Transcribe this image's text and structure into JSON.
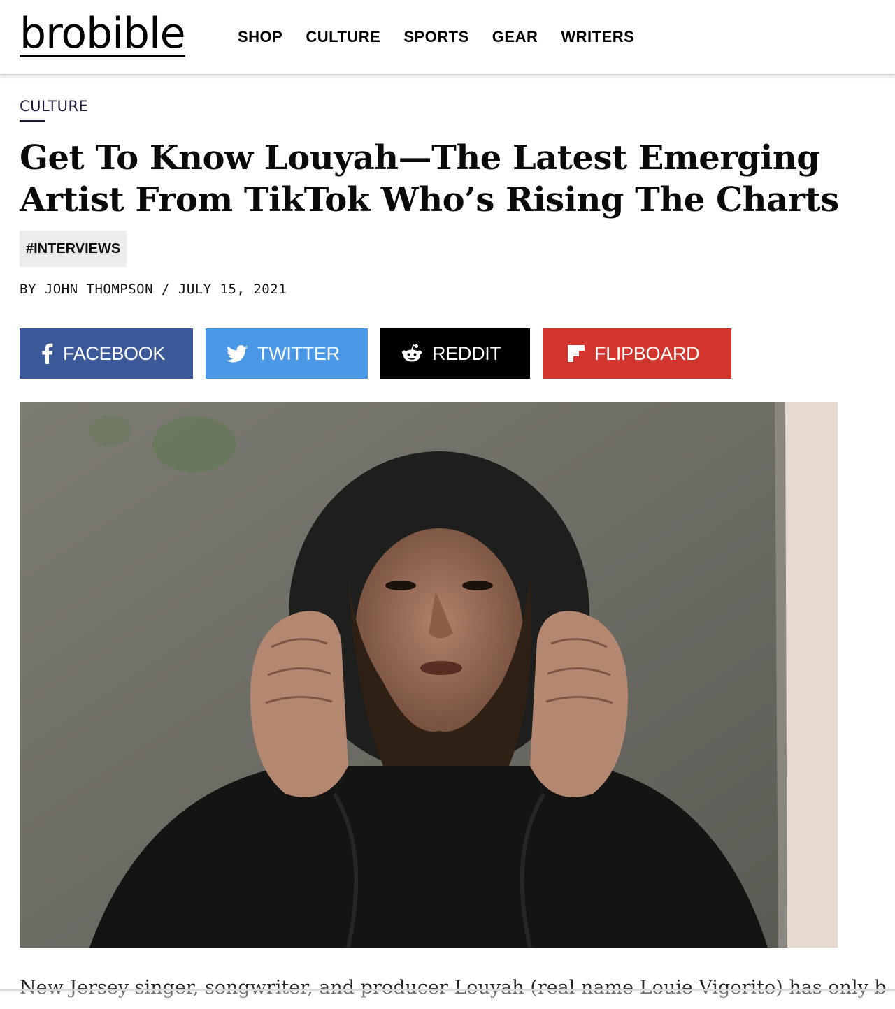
{
  "header": {
    "logo_text": "brobible",
    "nav": [
      "SHOP",
      "CULTURE",
      "SPORTS",
      "GEAR",
      "WRITERS"
    ]
  },
  "article": {
    "category": "CULTURE",
    "title": "Get To Know Louyah—The Latest Emerging Artist From TikTok Who’s Rising The Charts",
    "tag": "#INTERVIEWS",
    "byline": {
      "prefix": "BY",
      "author": "JOHN THOMPSON",
      "separator": "/",
      "date": "JULY 15, 2021"
    },
    "share": {
      "facebook": {
        "label": "FACEBOOK",
        "icon": "facebook-icon",
        "color": "#3b5998"
      },
      "twitter": {
        "label": "TWITTER",
        "icon": "twitter-icon",
        "color": "#4a97e5"
      },
      "reddit": {
        "label": "REDDIT",
        "icon": "reddit-icon",
        "color": "#000000"
      },
      "flipboard": {
        "label": "FLIPBOARD",
        "icon": "flipboard-icon",
        "color": "#d2352e"
      }
    },
    "body_first_line": "New Jersey singer, songwriter, and producer Louyah (real name Louie Vigorito) has only been on"
  }
}
